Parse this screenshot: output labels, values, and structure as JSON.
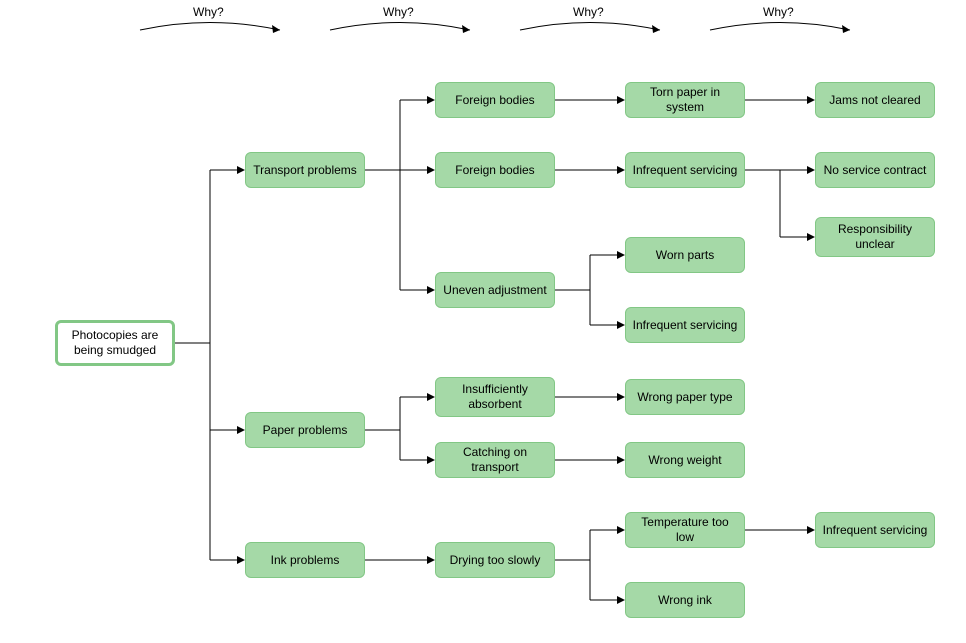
{
  "header_labels": {
    "why1": "Why?",
    "why2": "Why?",
    "why3": "Why?",
    "why4": "Why?"
  },
  "root": {
    "label": "Photocopies are being smudged"
  },
  "level1": {
    "transport": {
      "label": "Transport problems"
    },
    "paper": {
      "label": "Paper problems"
    },
    "ink": {
      "label": "Ink problems"
    }
  },
  "transport_children": {
    "foreign1": {
      "label": "Foreign bodies"
    },
    "foreign2": {
      "label": "Foreign bodies"
    },
    "uneven": {
      "label": "Uneven adjustment"
    }
  },
  "foreign1_children": {
    "torn": {
      "label": "Torn paper in system"
    }
  },
  "torn_children": {
    "jams": {
      "label": "Jams not cleared"
    }
  },
  "foreign2_children": {
    "infreq1": {
      "label": "Infrequent servicing"
    }
  },
  "infreq1_children": {
    "nocontract": {
      "label": "No service contract"
    },
    "responsibility": {
      "label": "Responsibility unclear"
    }
  },
  "uneven_children": {
    "worn": {
      "label": "Worn parts"
    },
    "infreq2": {
      "label": "Infrequent servicing"
    }
  },
  "paper_children": {
    "insuff": {
      "label": "Insufficiently absorbent"
    },
    "catching": {
      "label": "Catching on transport"
    }
  },
  "insuff_children": {
    "wrongpaper": {
      "label": "Wrong paper type"
    }
  },
  "catching_children": {
    "wrongweight": {
      "label": "Wrong weight"
    }
  },
  "ink_children": {
    "drying": {
      "label": "Drying too slowly"
    }
  },
  "drying_children": {
    "temp": {
      "label": "Temperature too low"
    },
    "wrongink": {
      "label": "Wrong ink"
    }
  },
  "temp_children": {
    "infreq3": {
      "label": "Infrequent servicing"
    }
  }
}
